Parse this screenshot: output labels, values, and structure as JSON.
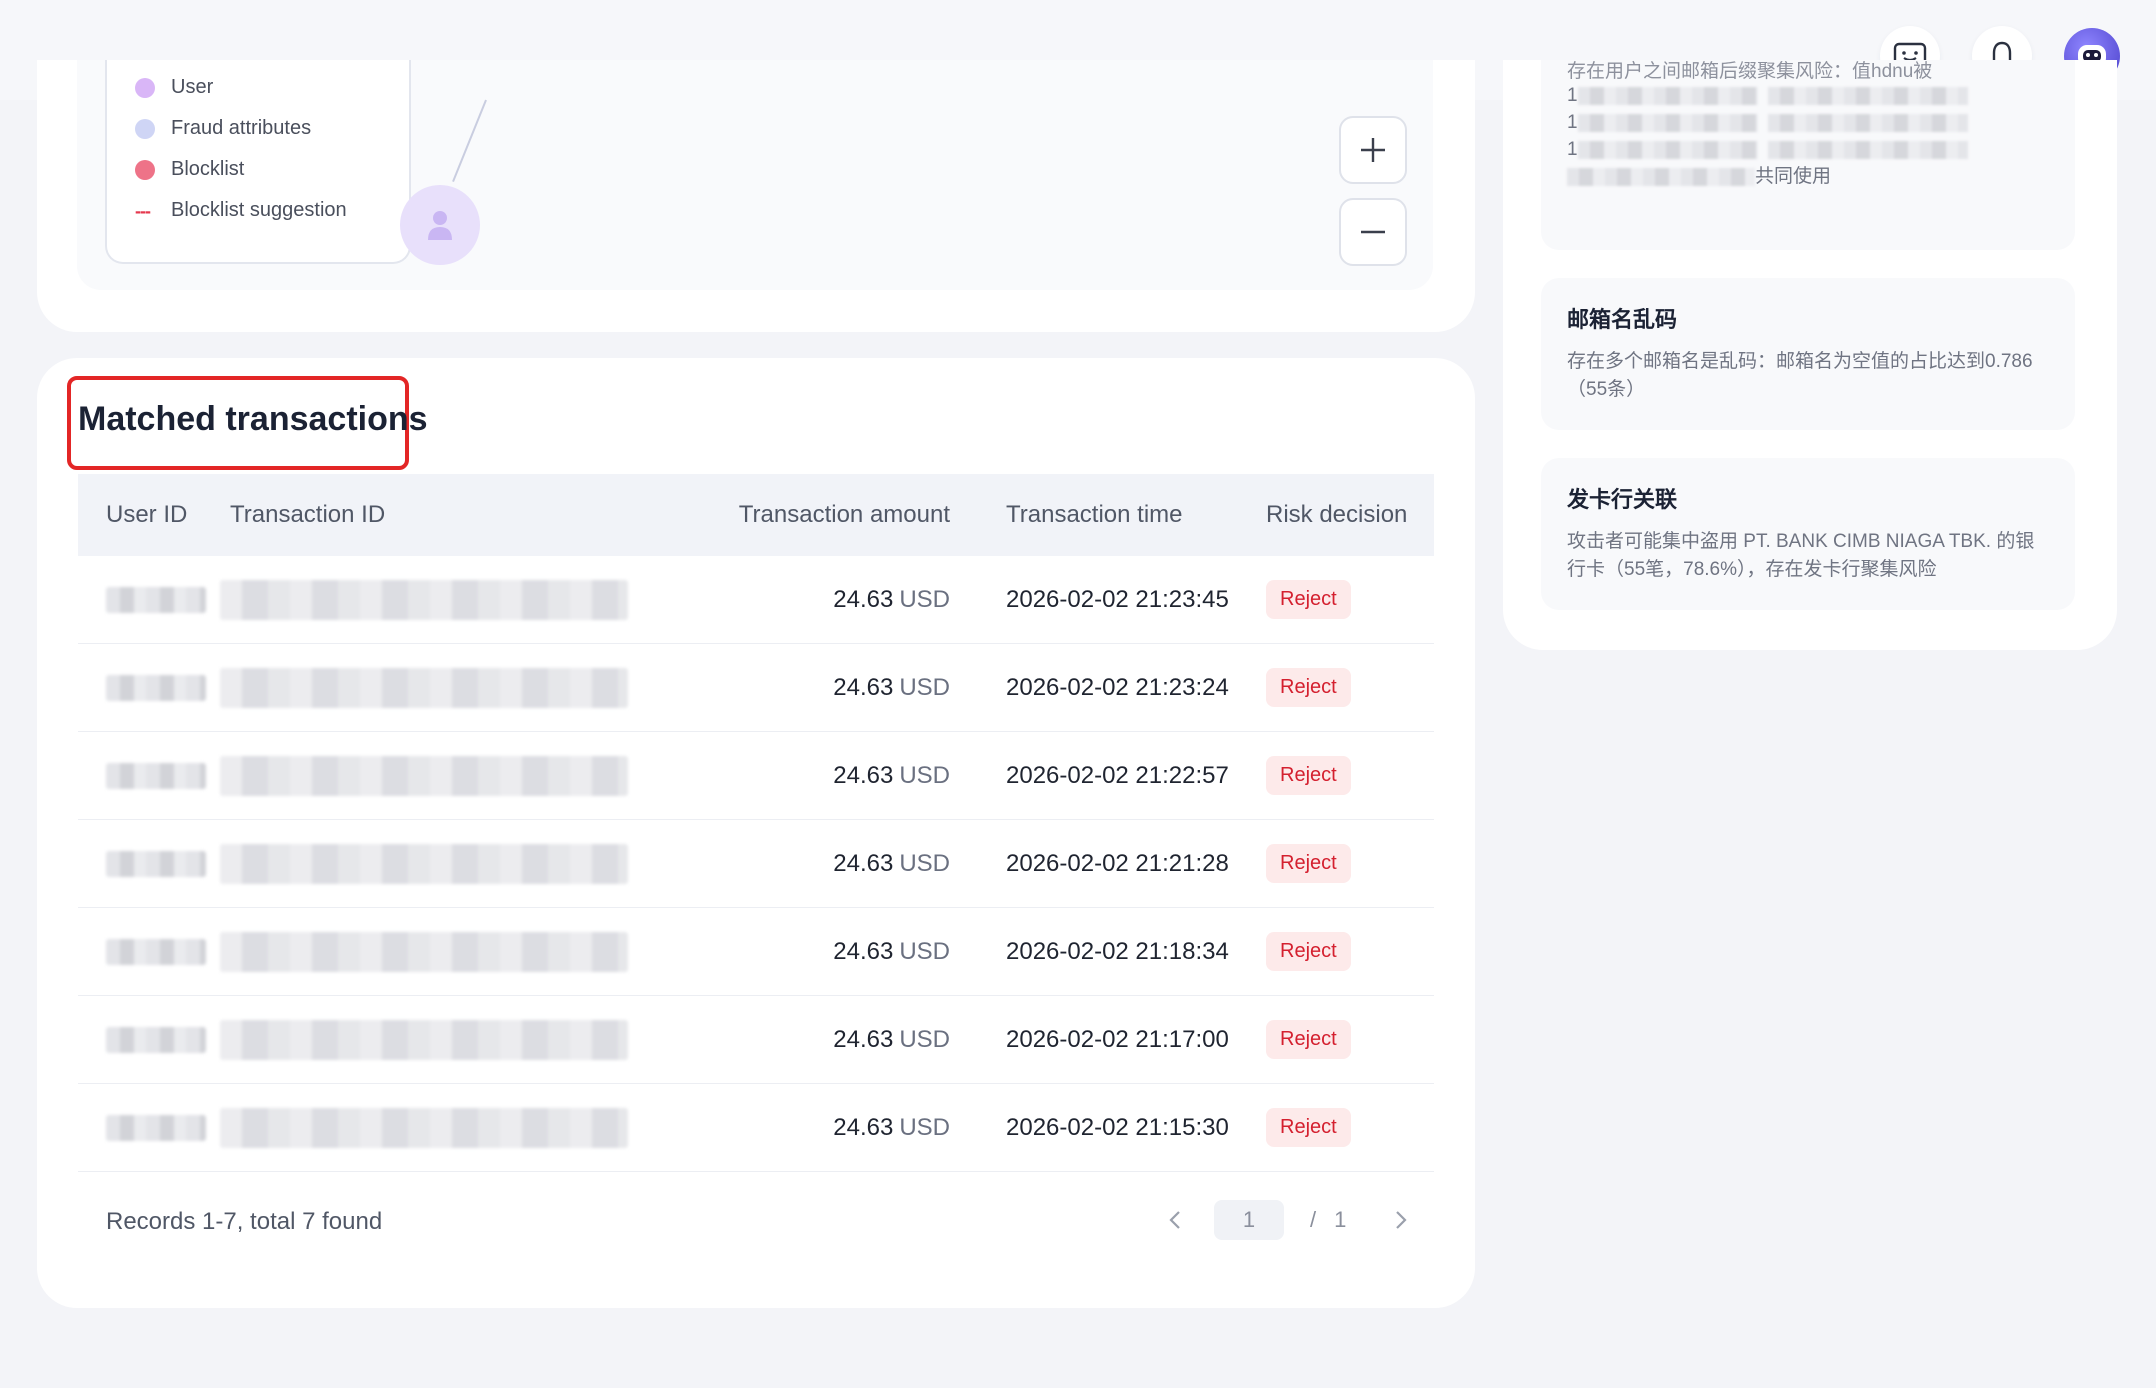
{
  "legend": {
    "items": [
      {
        "label": "User",
        "color": "#d9b6f7"
      },
      {
        "label": "Fraud attributes",
        "color": "#cfd5f5"
      },
      {
        "label": "Blocklist",
        "color": "#ee7388"
      },
      {
        "label": "Blocklist suggestion",
        "color": "#e5384e",
        "style": "dashed"
      }
    ]
  },
  "zoom": {
    "in_icon": "plus-icon",
    "out_icon": "minus-icon"
  },
  "transactions": {
    "title": "Matched transactions",
    "columns": [
      "User ID",
      "Transaction ID",
      "Transaction amount",
      "Transaction time",
      "Risk decision"
    ],
    "rows": [
      {
        "amount": "24.63",
        "currency": "USD",
        "time": "2026-02-02 21:23:45",
        "decision": "Reject"
      },
      {
        "amount": "24.63",
        "currency": "USD",
        "time": "2026-02-02 21:23:24",
        "decision": "Reject"
      },
      {
        "amount": "24.63",
        "currency": "USD",
        "time": "2026-02-02 21:22:57",
        "decision": "Reject"
      },
      {
        "amount": "24.63",
        "currency": "USD",
        "time": "2026-02-02 21:21:28",
        "decision": "Reject"
      },
      {
        "amount": "24.63",
        "currency": "USD",
        "time": "2026-02-02 21:18:34",
        "decision": "Reject"
      },
      {
        "amount": "24.63",
        "currency": "USD",
        "time": "2026-02-02 21:17:00",
        "decision": "Reject"
      },
      {
        "amount": "24.63",
        "currency": "USD",
        "time": "2026-02-02 21:15:30",
        "decision": "Reject"
      }
    ],
    "footer": "Records 1-7, total 7 found",
    "pagination": {
      "current": "1",
      "separator": "/",
      "total": "1"
    }
  },
  "right_panel": {
    "email_risk_partial": "存在用户之间邮箱后缀聚集风险：值hdnu被",
    "email_risk_prefix": "1",
    "email_risk_suffix": "共同使用",
    "cards": [
      {
        "title": "邮箱名乱码",
        "desc": "存在多个邮箱名是乱码：邮箱名为空值的占比达到0.786（55条）"
      },
      {
        "title": "发卡行关联",
        "desc": "攻击者可能集中盗用 PT. BANK CIMB NIAGA TBK. 的银行卡（55笔，78.6%），存在发卡行聚集风险"
      }
    ]
  },
  "colors": {
    "accent_red": "#d4202f",
    "highlight_box": "#e32626",
    "avatar": "#4a3fc9"
  }
}
